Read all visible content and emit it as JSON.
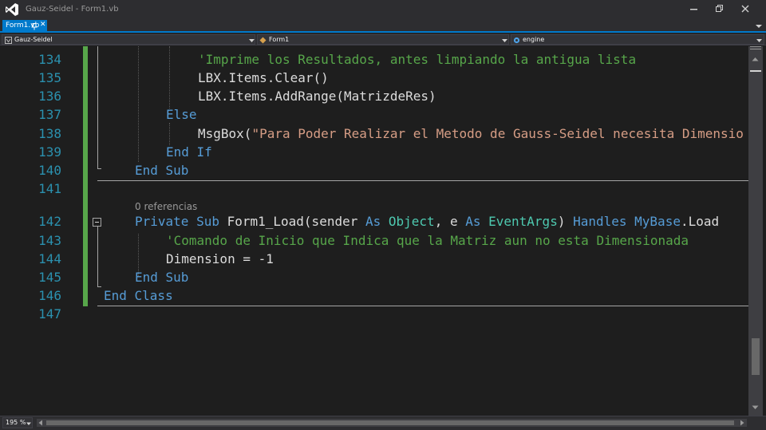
{
  "window": {
    "title": "Gauz-Seidel - Form1.vb",
    "controls": [
      "minimize-icon",
      "restore-icon",
      "close-icon"
    ]
  },
  "tabs": [
    {
      "label": "Form1.vb",
      "pin_icon": "pin-icon",
      "close_glyph": "✕",
      "active": true
    }
  ],
  "navbar": {
    "project": "Gauz-Seidel",
    "class": "Form1",
    "member": "engine"
  },
  "editor": {
    "line_numbers": [
      "134",
      "135",
      "136",
      "137",
      "138",
      "139",
      "140",
      "141",
      "142",
      "143",
      "144",
      "145",
      "146",
      "147"
    ],
    "codelens": "0 referencias",
    "lines": [
      {
        "num": "134",
        "tokens": [
          {
            "t": "cm",
            "v": "'Imprime los Resultados, antes limpiando la antigua lista"
          }
        ]
      },
      {
        "num": "135",
        "tokens": [
          {
            "t": "pl",
            "v": "LBX.Items.Clear()"
          }
        ]
      },
      {
        "num": "136",
        "tokens": [
          {
            "t": "pl",
            "v": "LBX.Items.AddRange(MatrizdeRes)"
          }
        ]
      },
      {
        "num": "137",
        "tokens": [
          {
            "t": "kw",
            "v": "Else"
          }
        ]
      },
      {
        "num": "138",
        "tokens": [
          {
            "t": "pl",
            "v": "MsgBox("
          },
          {
            "t": "st",
            "v": "\"Para Poder Realizar el Metodo de Gauss-Seidel necesita Dimensio"
          }
        ]
      },
      {
        "num": "139",
        "tokens": [
          {
            "t": "kw",
            "v": "End If"
          }
        ]
      },
      {
        "num": "140",
        "tokens": [
          {
            "t": "kw",
            "v": "End Sub"
          }
        ]
      },
      {
        "num": "141",
        "tokens": []
      },
      {
        "num": "142",
        "tokens": [
          {
            "t": "kw",
            "v": "Private Sub "
          },
          {
            "t": "pl",
            "v": "Form1_Load(sender "
          },
          {
            "t": "kw",
            "v": "As "
          },
          {
            "t": "ty",
            "v": "Object"
          },
          {
            "t": "pl",
            "v": ", e "
          },
          {
            "t": "kw",
            "v": "As "
          },
          {
            "t": "ty",
            "v": "EventArgs"
          },
          {
            "t": "pl",
            "v": ") "
          },
          {
            "t": "kw",
            "v": "Handles MyBase"
          },
          {
            "t": "pl",
            "v": ".Load"
          }
        ]
      },
      {
        "num": "143",
        "tokens": [
          {
            "t": "cm",
            "v": "'Comando de Inicio que Indica que la Matriz aun no esta Dimensionada"
          }
        ]
      },
      {
        "num": "144",
        "tokens": [
          {
            "t": "pl",
            "v": "Dimension = -1"
          }
        ]
      },
      {
        "num": "145",
        "tokens": [
          {
            "t": "kw",
            "v": "End Sub"
          }
        ]
      },
      {
        "num": "146",
        "tokens": [
          {
            "t": "kw",
            "v": "End Class"
          }
        ]
      },
      {
        "num": "147",
        "tokens": []
      }
    ]
  },
  "statusbar": {
    "zoom": "195 %"
  },
  "colors": {
    "accent": "#007acc",
    "keyword": "#569cd6",
    "comment": "#57a64a",
    "string": "#d69d85",
    "type": "#4ec9b0",
    "line_number": "#2b91af",
    "background": "#1e1e1e"
  }
}
